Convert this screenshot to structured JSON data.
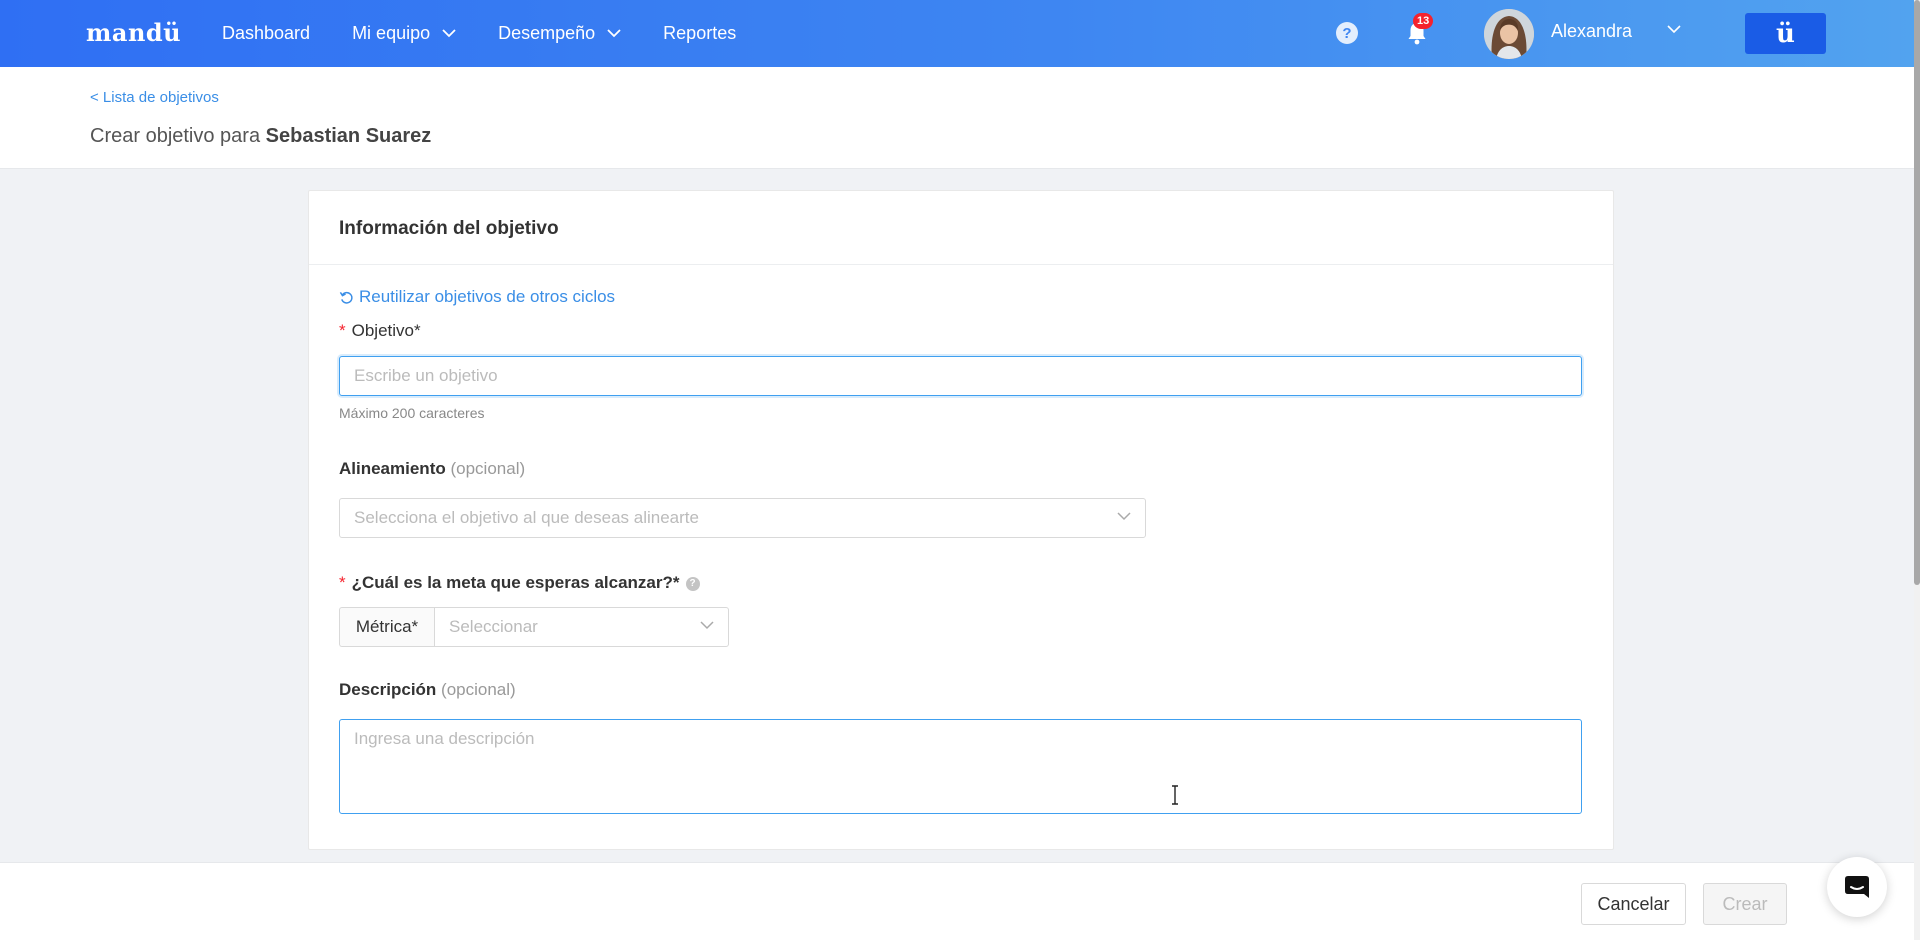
{
  "topbar": {
    "logo": "mandü",
    "nav": [
      {
        "label": "Dashboard",
        "dropdown": false
      },
      {
        "label": "Mi equipo",
        "dropdown": true
      },
      {
        "label": "Desempeño",
        "dropdown": true
      },
      {
        "label": "Reportes",
        "dropdown": false
      }
    ],
    "help_icon": "?",
    "notification_count": "13",
    "user_name": "Alexandra",
    "brand_button": "ü"
  },
  "header": {
    "back_link": "< Lista de objetivos",
    "title_prefix": "Crear objetivo para",
    "title_name": "Sebastian Suarez"
  },
  "form": {
    "section_title": "Información del objetivo",
    "reuse_link": "Reutilizar objetivos de otros ciclos",
    "objetivo_label": "Objetivo*",
    "objetivo_placeholder": "Escribe un objetivo",
    "objetivo_hint": "Máximo 200 caracteres",
    "alineamiento_label": "Alineamiento",
    "alineamiento_optional": "(opcional)",
    "alineamiento_placeholder": "Selecciona el objetivo al que deseas alinearte",
    "meta_label": "¿Cuál es la meta que esperas alcanzar?*",
    "metrica_addon": "Métrica*",
    "metrica_placeholder": "Seleccionar",
    "descripcion_label": "Descripción",
    "descripcion_optional": "(opcional)",
    "descripcion_placeholder": "Ingresa una descripción"
  },
  "footer": {
    "cancel_label": "Cancelar",
    "create_label": "Crear"
  },
  "colors": {
    "topbar_start": "#2f6ff3",
    "topbar_end": "#52a3ef",
    "link": "#3a8ee6",
    "required": "#f5222d",
    "focus_border": "#40a0f0"
  }
}
